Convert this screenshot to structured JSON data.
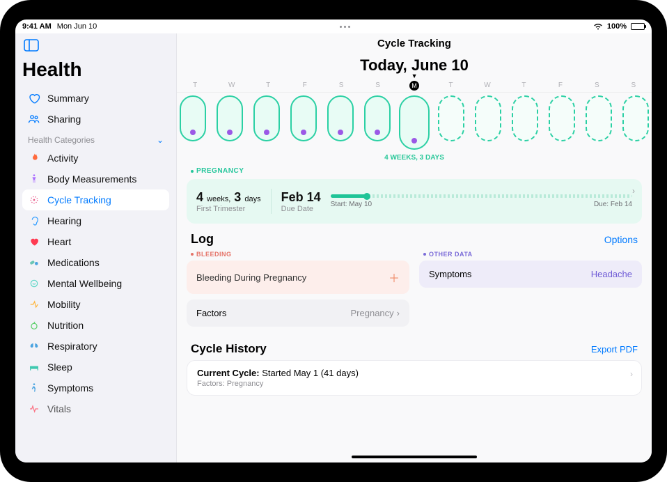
{
  "statusBar": {
    "time": "9:41 AM",
    "date": "Mon Jun 10",
    "batteryText": "100%"
  },
  "sidebar": {
    "appTitle": "Health",
    "summary": "Summary",
    "sharing": "Sharing",
    "sectionHeader": "Health Categories",
    "items": [
      {
        "label": "Activity"
      },
      {
        "label": "Body Measurements"
      },
      {
        "label": "Cycle Tracking"
      },
      {
        "label": "Hearing"
      },
      {
        "label": "Heart"
      },
      {
        "label": "Medications"
      },
      {
        "label": "Mental Wellbeing"
      },
      {
        "label": "Mobility"
      },
      {
        "label": "Nutrition"
      },
      {
        "label": "Respiratory"
      },
      {
        "label": "Sleep"
      },
      {
        "label": "Symptoms"
      },
      {
        "label": "Vitals"
      }
    ]
  },
  "main": {
    "title": "Cycle Tracking",
    "dateHeading": "Today, June 10",
    "days": [
      "T",
      "W",
      "T",
      "F",
      "S",
      "S",
      "M",
      "T",
      "W",
      "T",
      "F",
      "S",
      "S"
    ],
    "gestationText": "4 WEEKS, 3 DAYS",
    "pregnancy": {
      "sectionLabel": "PREGNANCY",
      "durationBig": "4",
      "durationUnit1": "weeks,",
      "durationBig2": "3",
      "durationUnit2": "days",
      "durationSub": "First Trimester",
      "dueDate": "Feb 14",
      "dueDateSub": "Due Date",
      "startLabel": "Start: May 10",
      "dueLabel": "Due: Feb 14"
    },
    "log": {
      "heading": "Log",
      "options": "Options",
      "bleedingLabel": "BLEEDING",
      "bleedingRow": "Bleeding During Pregnancy",
      "factorsLabel": "Factors",
      "factorsValue": "Pregnancy",
      "otherLabel": "OTHER DATA",
      "symptomsLabel": "Symptoms",
      "symptomsValue": "Headache"
    },
    "history": {
      "heading": "Cycle History",
      "export": "Export PDF",
      "currentLabel": "Current Cycle:",
      "currentValue": " Started May 1 (41 days)",
      "factorsLine": "Factors: Pregnancy"
    }
  }
}
